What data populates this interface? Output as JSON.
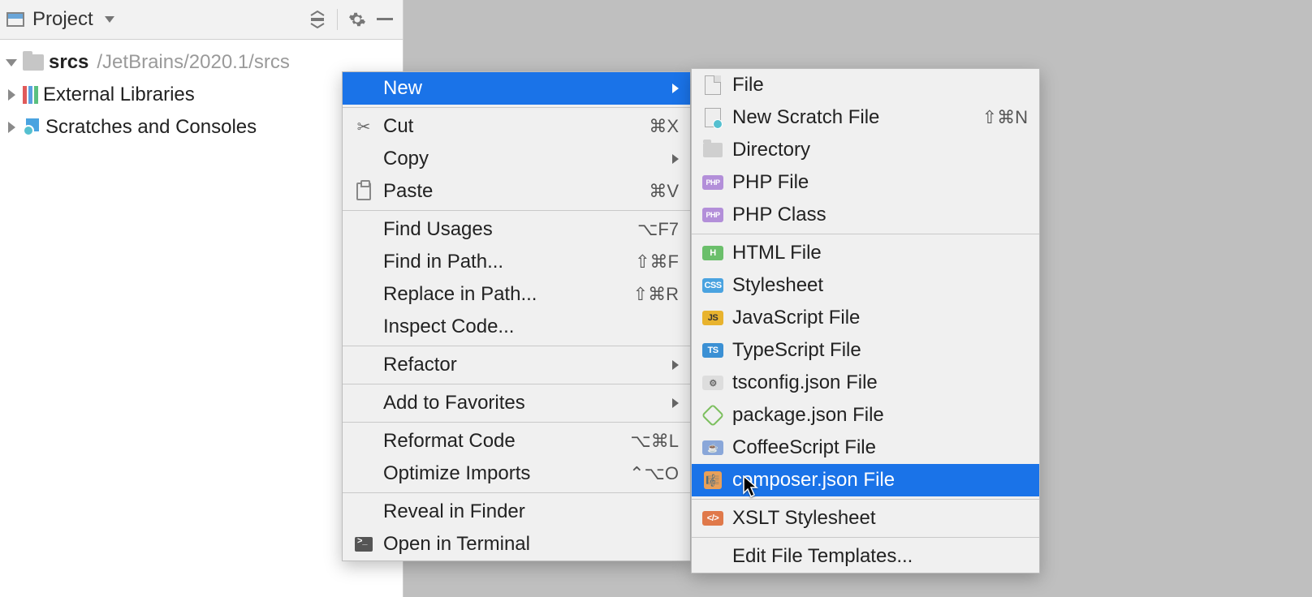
{
  "panel": {
    "title": "Project",
    "tree": {
      "root_name": "srcs",
      "root_path": "/JetBrains/2020.1/srcs",
      "ext_libs": "External Libraries",
      "scratches": "Scratches and Consoles"
    }
  },
  "context_menu": {
    "new": "New",
    "cut": {
      "label": "Cut",
      "shortcut": "⌘X"
    },
    "copy": "Copy",
    "paste": {
      "label": "Paste",
      "shortcut": "⌘V"
    },
    "find_usages": {
      "label": "Find Usages",
      "shortcut": "⌥F7"
    },
    "find_in_path": {
      "label": "Find in Path...",
      "shortcut": "⇧⌘F"
    },
    "replace_in_path": {
      "label": "Replace in Path...",
      "shortcut": "⇧⌘R"
    },
    "inspect_code": "Inspect Code...",
    "refactor": "Refactor",
    "add_favorites": "Add to Favorites",
    "reformat": {
      "label": "Reformat Code",
      "shortcut": "⌥⌘L"
    },
    "optimize": {
      "label": "Optimize Imports",
      "shortcut": "⌃⌥O"
    },
    "reveal": "Reveal in Finder",
    "open_terminal": "Open in Terminal"
  },
  "new_submenu": {
    "file": "File",
    "scratch": {
      "label": "New Scratch File",
      "shortcut": "⇧⌘N"
    },
    "directory": "Directory",
    "php_file": "PHP File",
    "php_class": "PHP Class",
    "html_file": "HTML File",
    "stylesheet": "Stylesheet",
    "js_file": "JavaScript File",
    "ts_file": "TypeScript File",
    "tsconfig": "tsconfig.json File",
    "package_json": "package.json File",
    "coffee": "CoffeeScript File",
    "composer": "composer.json File",
    "xslt": "XSLT Stylesheet",
    "edit_templates": "Edit File Templates..."
  },
  "icon_badges": {
    "php": "PHP",
    "h": "H",
    "css": "CSS",
    "js": "JS",
    "ts": "TS",
    "xslt": "</>"
  }
}
